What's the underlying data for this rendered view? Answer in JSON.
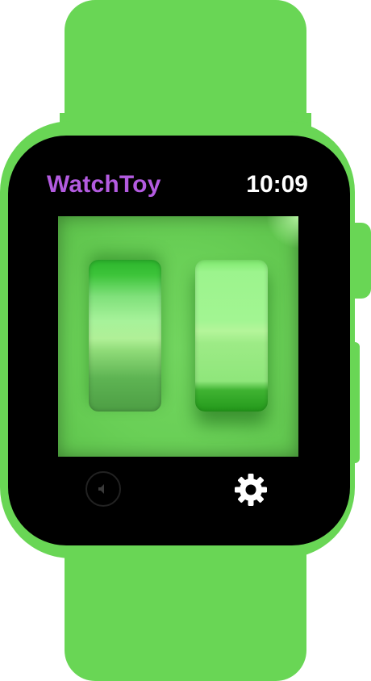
{
  "app": {
    "title": "WatchToy",
    "time": "10:09"
  },
  "colors": {
    "band": "#69d655",
    "title": "#b35be0",
    "screen": "#000000",
    "toy_background": "#69cf56"
  },
  "toy": {
    "switches": [
      {
        "name": "left",
        "state": "depressed-top"
      },
      {
        "name": "right",
        "state": "depressed-bottom"
      }
    ]
  },
  "controls": {
    "sound_icon": "speaker-muted-icon",
    "settings_icon": "gear-icon"
  }
}
